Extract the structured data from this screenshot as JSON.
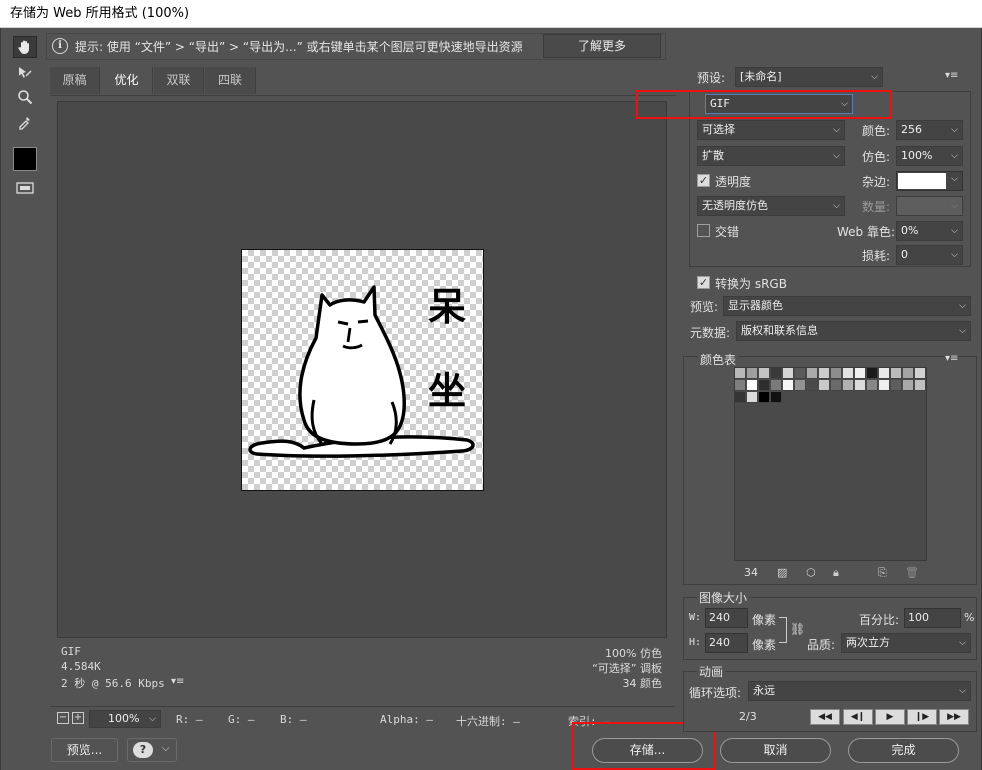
{
  "window": {
    "title": "存储为 Web 所用格式 (100%)"
  },
  "hint": {
    "text": "提示: 使用 “文件” > “导出” > “导出为...” 或右键单击某个图层可更快速地导出资源",
    "learn_more": "了解更多"
  },
  "tabs": [
    {
      "label": "原稿"
    },
    {
      "label": "优化"
    },
    {
      "label": "双联"
    },
    {
      "label": "四联"
    }
  ],
  "preview": {
    "image_text": [
      "呆",
      "坐"
    ],
    "info_left": [
      "GIF",
      "4.584K",
      "2 秒 @ 56.6 Kbps"
    ],
    "info_right": [
      "100% 仿色",
      "“可选择” 调板",
      "34 颜色"
    ]
  },
  "status": {
    "zoom": "100%",
    "r": "R: —",
    "g": "G: —",
    "b": "B: —",
    "alpha": "Alpha: —",
    "hex": "十六进制: —",
    "index": "索引: —"
  },
  "buttons": {
    "preview": "预览...",
    "save": "存储...",
    "cancel": "取消",
    "done": "完成"
  },
  "settings": {
    "preset_label": "预设:",
    "preset_value": "[未命名]",
    "format": "GIF",
    "reduction": "可选择",
    "colors_label": "颜色:",
    "colors_value": "256",
    "dither_algo": "扩散",
    "dither_label": "仿色:",
    "dither_value": "100%",
    "transparency_label": "透明度",
    "transparency_checked": true,
    "matte_label": "杂边:",
    "matte_color": "#ffffff",
    "trans_dither": "无透明度仿色",
    "amount_label": "数量:",
    "interlaced_label": "交错",
    "interlaced_checked": false,
    "web_snap_label": "Web 靠色:",
    "web_snap_value": "0%",
    "lossy_label": "损耗:",
    "lossy_value": "0",
    "convert_srgb_label": "转换为 sRGB",
    "convert_srgb_checked": true,
    "preview_label": "预览:",
    "preview_value": "显示器颜色",
    "metadata_label": "元数据:",
    "metadata_value": "版权和联系信息"
  },
  "color_table": {
    "title": "颜色表",
    "count": "34",
    "colors": [
      "#b8b8b8",
      "#9e9e9e",
      "#c4c4c4",
      "#3a3a3a",
      "#d6d6d6",
      "#5a5a5a",
      "#ababab",
      "#cdcdcd",
      "#8c8c8c",
      "#e1e1e1",
      "#f0f0f0",
      "#1a1a1a",
      "#e9e9e9",
      "#bcbcbc",
      "#a4a4a4",
      "#d1d1d1",
      "#7f7f7f",
      "#ffffff",
      "#2e2e2e",
      "#7a7a7a",
      "#f6f6f6",
      "#929292",
      "#4a4a4a",
      "#c9c9c9",
      "#6a6a6a",
      "#b0b0b0",
      "#dadada",
      "#878787",
      "#efefef",
      "#5e5e5e",
      "#a9a9a9",
      "#c0c0c0",
      "#353535",
      "#d9d9d9",
      "#000000",
      "#111111"
    ]
  },
  "image_size": {
    "title": "图像大小",
    "w_label": "W:",
    "w_value": "240",
    "h_label": "H:",
    "h_value": "240",
    "unit": "像素",
    "percent_label": "百分比:",
    "percent_value": "100",
    "percent_unit": "%",
    "quality_label": "品质:",
    "quality_value": "两次立方"
  },
  "animation": {
    "title": "动画",
    "loop_label": "循环选项:",
    "loop_value": "永远",
    "frame": "2/3"
  }
}
